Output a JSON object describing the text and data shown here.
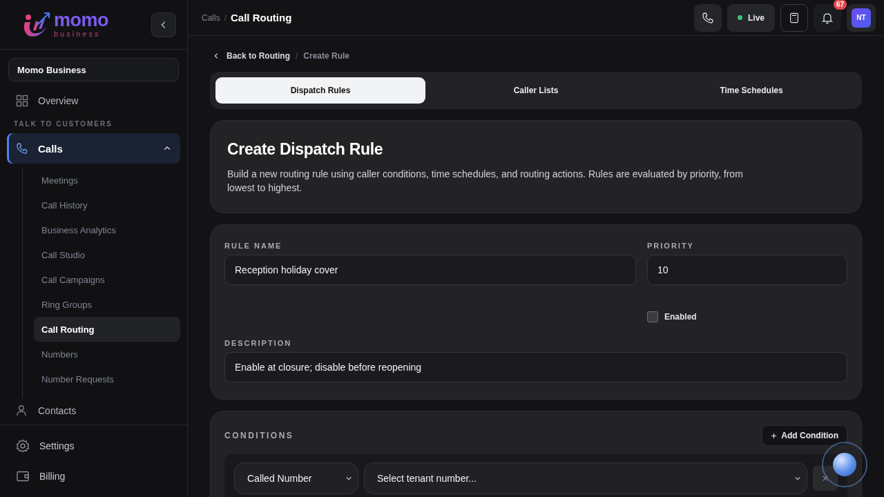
{
  "sidebar": {
    "brand": {
      "name": "momo",
      "tagline": "business"
    },
    "workspace": "Momo Business",
    "items": [
      {
        "label": "Overview",
        "selected": false
      }
    ],
    "section": "TALK TO CUSTOMERS",
    "calls": {
      "label": "Calls",
      "expanded": true,
      "selected": true,
      "children": [
        {
          "label": "Meetings",
          "selected": false
        },
        {
          "label": "Call History",
          "selected": false
        },
        {
          "label": "Business Analytics",
          "selected": false
        },
        {
          "label": "Call Studio",
          "selected": false
        },
        {
          "label": "Call Campaigns",
          "selected": false
        },
        {
          "label": "Ring Groups",
          "selected": false
        },
        {
          "label": "Call Routing",
          "selected": true
        },
        {
          "label": "Numbers",
          "selected": false
        },
        {
          "label": "Number Requests",
          "selected": false
        }
      ]
    },
    "more": [
      {
        "label": "Contacts",
        "selected": false
      }
    ],
    "footer": [
      {
        "label": "Settings"
      },
      {
        "label": "Billing"
      }
    ]
  },
  "topbar": {
    "breadcrumb": [
      "Calls",
      "Call Routing"
    ],
    "separator": "/",
    "live": {
      "label": "Live",
      "on": true
    },
    "notifications": "67",
    "avatar": "NT"
  },
  "page_breadcrumb": {
    "back": "Back to Routing",
    "separator": "/",
    "current": "Create Rule"
  },
  "tabs": [
    {
      "label": "Dispatch Rules",
      "selected": true
    },
    {
      "label": "Caller Lists",
      "selected": false
    },
    {
      "label": "Time Schedules",
      "selected": false
    }
  ],
  "intro": {
    "title": "Create Dispatch Rule",
    "text": "Build a new routing rule using caller conditions, time schedules, and routing actions. Rules are evaluated by priority, from lowest to highest."
  },
  "form": {
    "rule_name": {
      "label": "RULE NAME",
      "value": "Reception holiday cover"
    },
    "priority": {
      "label": "PRIORITY",
      "value": "10"
    },
    "enabled": {
      "label": "Enabled",
      "checked": false
    },
    "description": {
      "label": "DESCRIPTION",
      "value": "Enable at closure; disable before reopening"
    }
  },
  "conditions": {
    "title": "CONDITIONS",
    "add_button": "Add Condition",
    "rows": [
      {
        "field": "Called Number",
        "placeholder": "Select tenant number..."
      }
    ]
  }
}
